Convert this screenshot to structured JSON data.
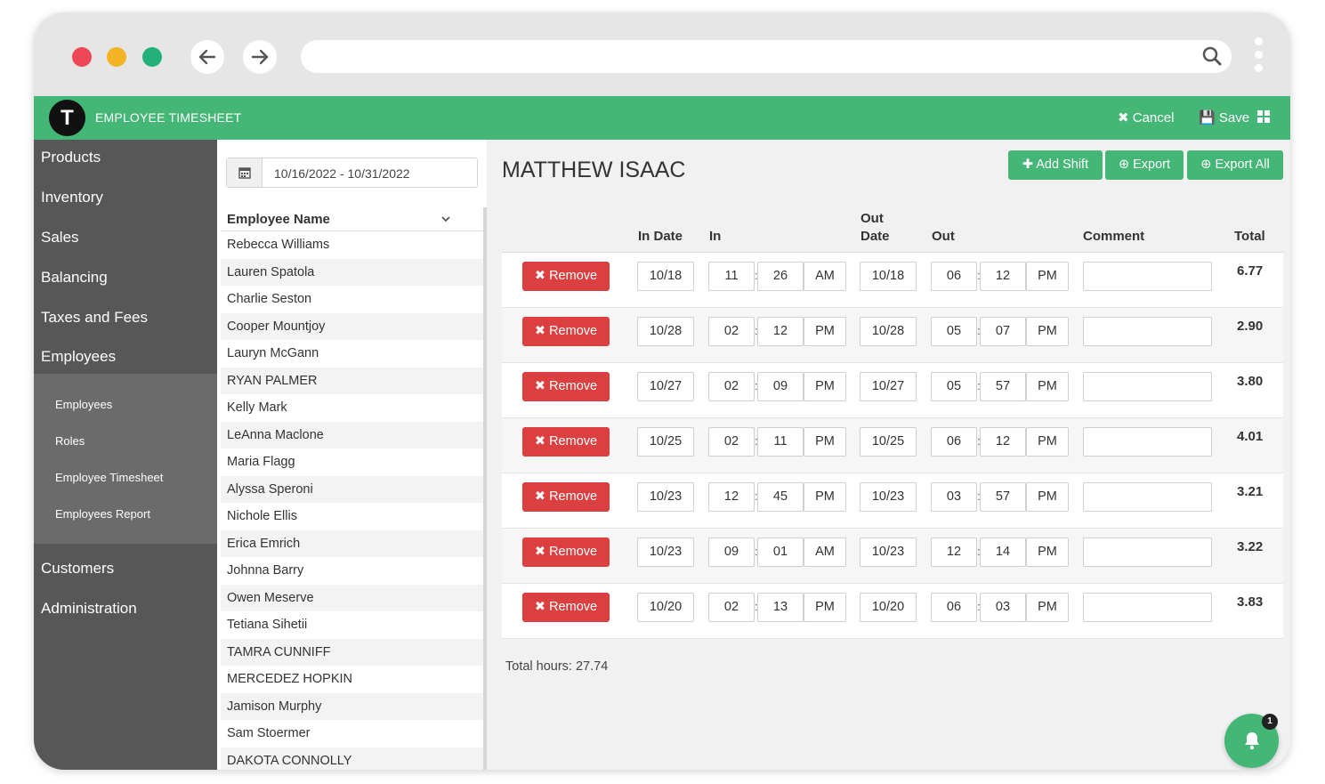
{
  "app": {
    "title": "EMPLOYEE TIMESHEET",
    "logo_letter": "T"
  },
  "toolbar": {
    "cancel_label": "✖ Cancel",
    "save_label": "💾 Save"
  },
  "sidebar": {
    "items": [
      "Products",
      "Inventory",
      "Sales",
      "Balancing",
      "Taxes and Fees",
      "Employees"
    ],
    "sub_items": [
      "Employees",
      "Roles",
      "Employee Timesheet",
      "Employees Report"
    ],
    "bottom_items": [
      "Customers",
      "Administration"
    ]
  },
  "filter": {
    "date_range": "10/16/2022 - 10/31/2022"
  },
  "employee_list": {
    "header": "Employee Name",
    "names": [
      "Rebecca Williams",
      "Lauren Spatola",
      "Charlie Seston",
      "Cooper Mountjoy",
      "Lauryn McGann",
      "RYAN PALMER",
      "Kelly Mark",
      "LeAnna Maclone",
      "Maria Flagg",
      "Alyssa Speroni",
      "Nichole Ellis",
      "Erica Emrich",
      "Johnna Barry",
      "Owen Meserve",
      "Tetiana Sihetii",
      "TAMRA CUNNIFF",
      "MERCEDEZ HOPKIN",
      "Jamison Murphy",
      "Sam Stoermer",
      "DAKOTA CONNOLLY"
    ]
  },
  "timesheet": {
    "employee": "MATTHEW ISAAC",
    "buttons": {
      "add_shift": "✚ Add Shift",
      "export": "⊕ Export",
      "export_all": "⊕ Export All"
    },
    "columns": {
      "in_date": "In Date",
      "in": "In",
      "out_date_1": "Out",
      "out_date_2": "Date",
      "out": "Out",
      "comment": "Comment",
      "total": "Total"
    },
    "remove_label": "✖ Remove",
    "rows": [
      {
        "in_date": "10/18",
        "in_h": "11",
        "in_m": "26",
        "in_ap": "AM",
        "out_date": "10/18",
        "out_h": "06",
        "out_m": "12",
        "out_ap": "PM",
        "comment": "",
        "total": "6.77"
      },
      {
        "in_date": "10/28",
        "in_h": "02",
        "in_m": "12",
        "in_ap": "PM",
        "out_date": "10/28",
        "out_h": "05",
        "out_m": "07",
        "out_ap": "PM",
        "comment": "",
        "total": "2.90"
      },
      {
        "in_date": "10/27",
        "in_h": "02",
        "in_m": "09",
        "in_ap": "PM",
        "out_date": "10/27",
        "out_h": "05",
        "out_m": "57",
        "out_ap": "PM",
        "comment": "",
        "total": "3.80"
      },
      {
        "in_date": "10/25",
        "in_h": "02",
        "in_m": "11",
        "in_ap": "PM",
        "out_date": "10/25",
        "out_h": "06",
        "out_m": "12",
        "out_ap": "PM",
        "comment": "",
        "total": "4.01"
      },
      {
        "in_date": "10/23",
        "in_h": "12",
        "in_m": "45",
        "in_ap": "PM",
        "out_date": "10/23",
        "out_h": "03",
        "out_m": "57",
        "out_ap": "PM",
        "comment": "",
        "total": "3.21"
      },
      {
        "in_date": "10/23",
        "in_h": "09",
        "in_m": "01",
        "in_ap": "AM",
        "out_date": "10/23",
        "out_h": "12",
        "out_m": "14",
        "out_ap": "PM",
        "comment": "",
        "total": "3.22"
      },
      {
        "in_date": "10/20",
        "in_h": "02",
        "in_m": "13",
        "in_ap": "PM",
        "out_date": "10/20",
        "out_h": "06",
        "out_m": "03",
        "out_ap": "PM",
        "comment": "",
        "total": "3.83"
      }
    ],
    "total_hours": "Total hours: 27.74"
  },
  "notifications": {
    "count": "1"
  },
  "colors": {
    "brand_green": "#44b676",
    "remove_red": "#dc3f3f",
    "sidebar": "#575757",
    "subnav": "#6b6b6b"
  }
}
